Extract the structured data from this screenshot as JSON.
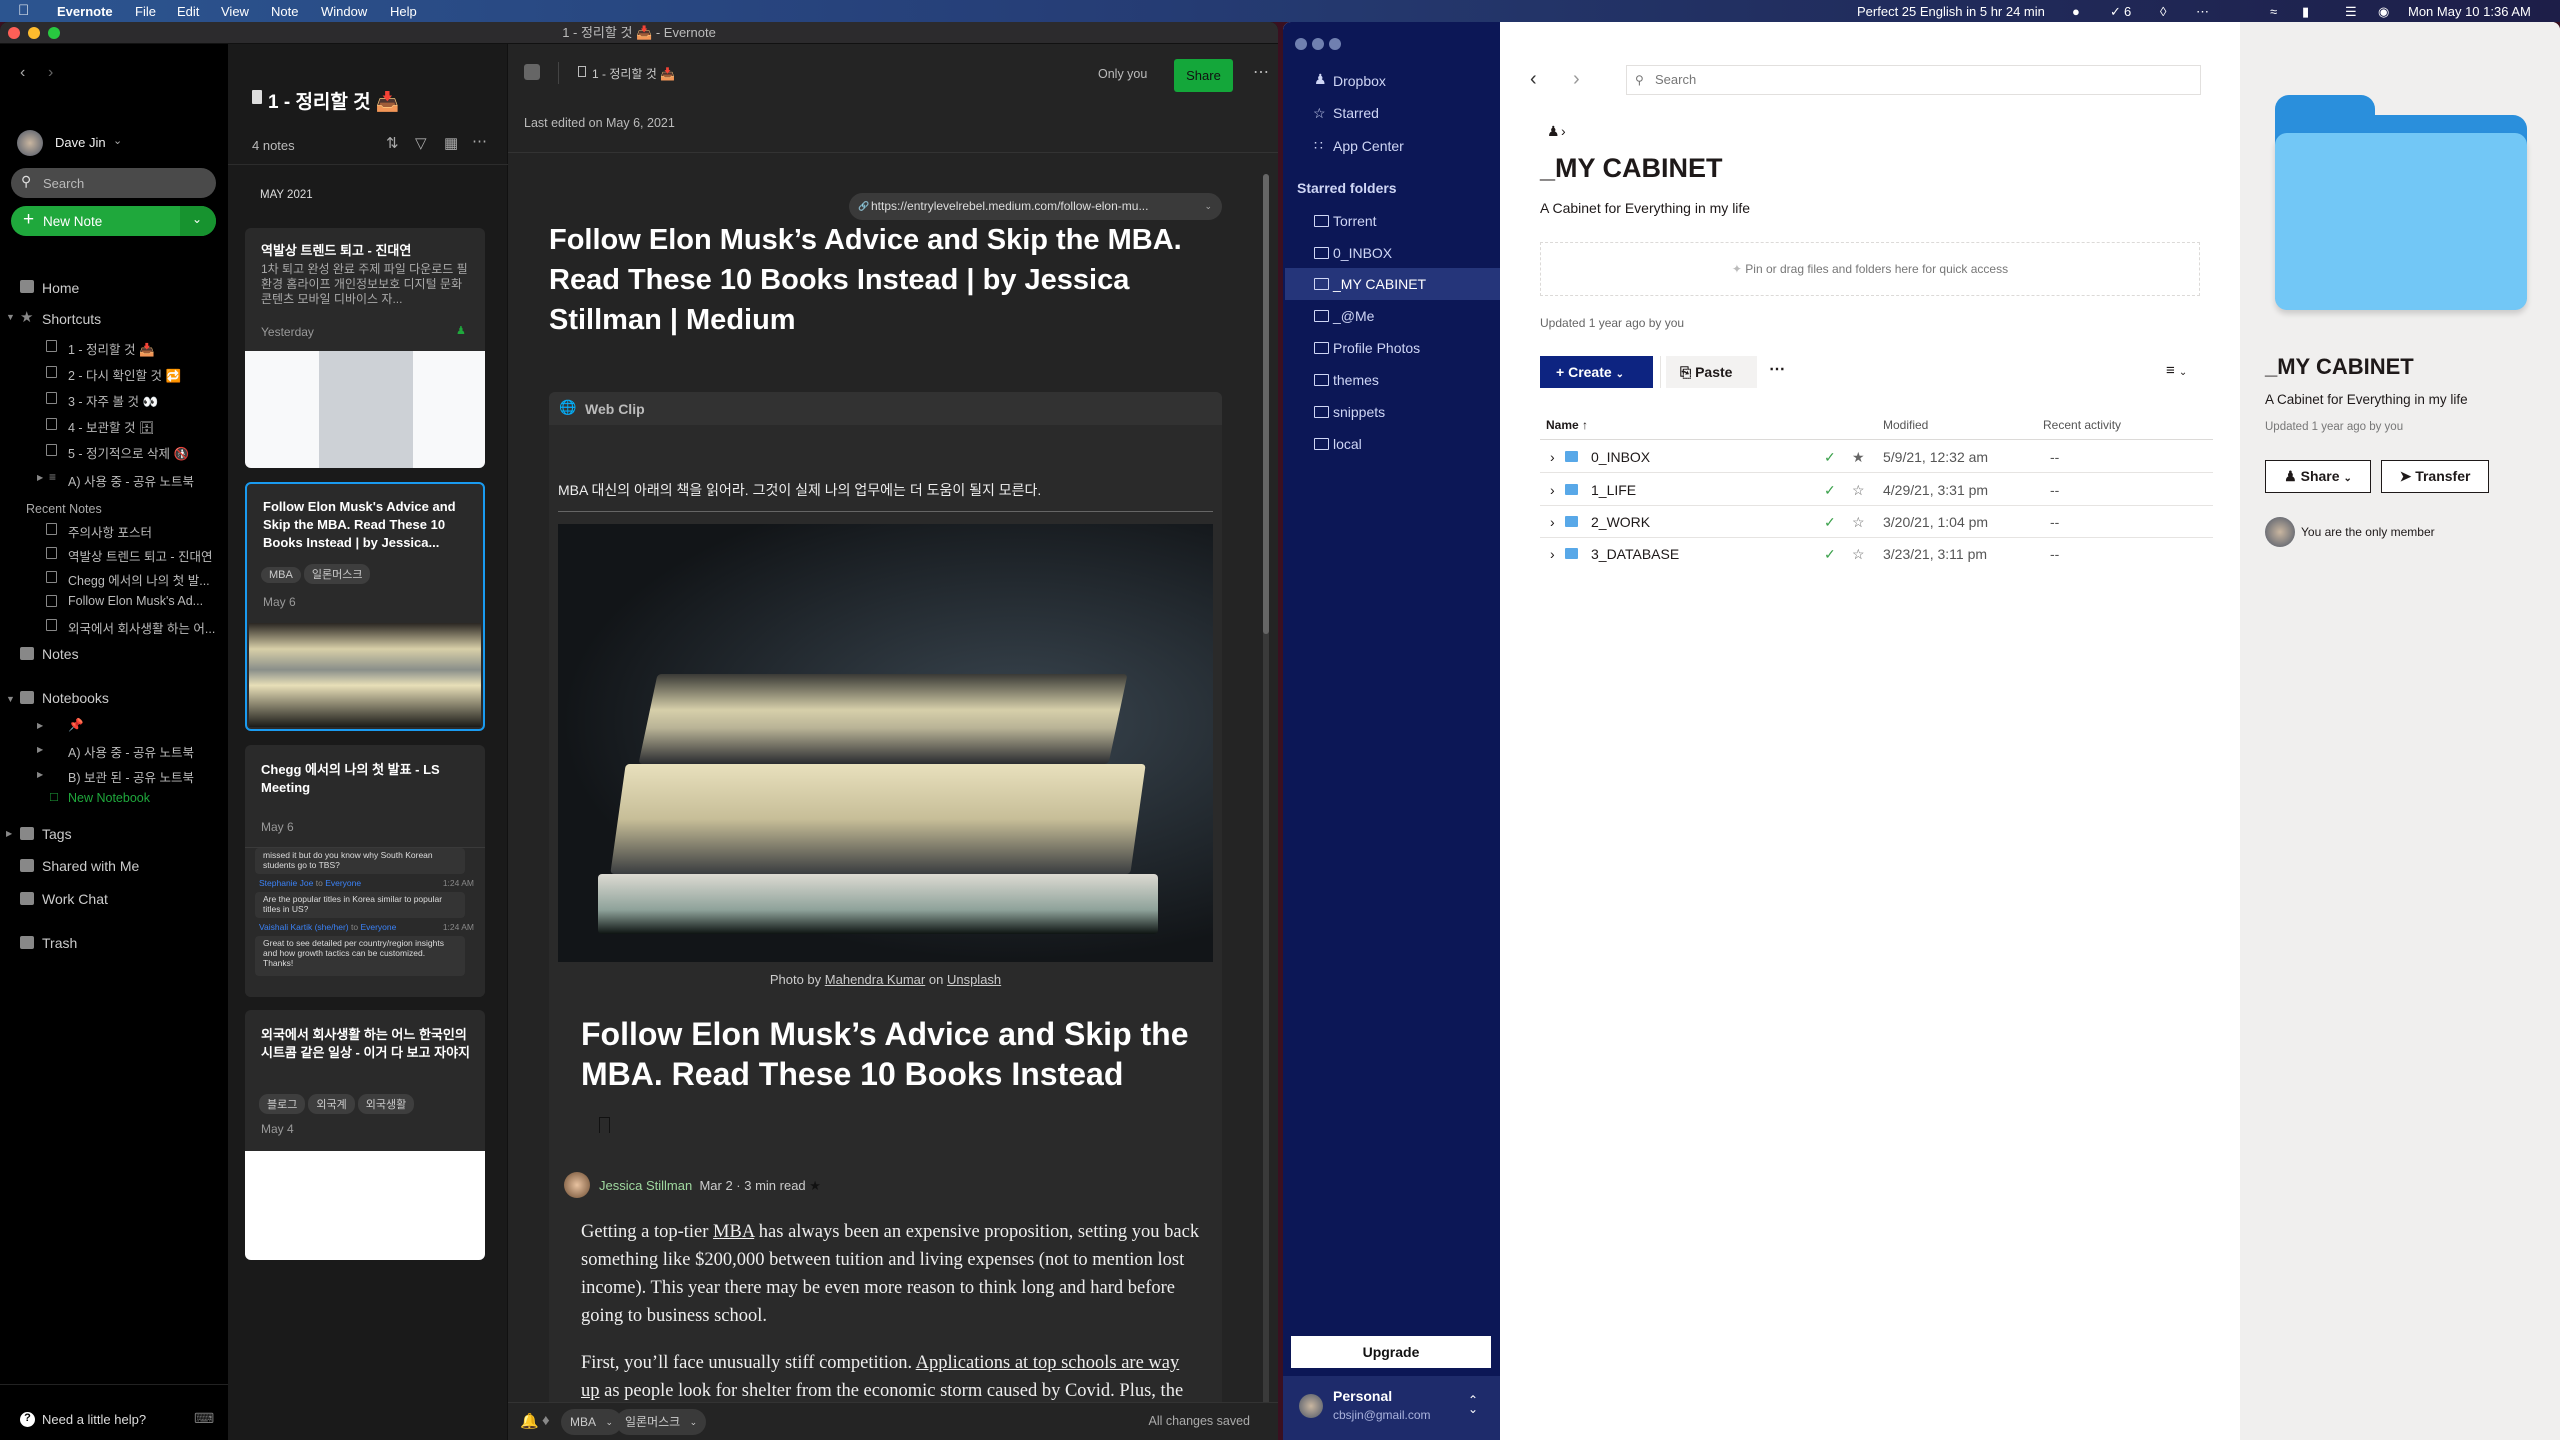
{
  "menubar": {
    "app": "Evernote",
    "items": [
      "File",
      "Edit",
      "View",
      "Note",
      "Window",
      "Help"
    ],
    "status": "Perfect 25 English in 5 hr 24 min",
    "badge": "6",
    "clock": "Mon May 10  1:36 AM"
  },
  "evernote": {
    "window_title": "1 - 정리할 것 📥 - Evernote",
    "sidebar": {
      "user": "Dave Jin",
      "search_placeholder": "Search",
      "new_note": "New Note",
      "home": "Home",
      "shortcuts": "Shortcuts",
      "shortcut_items": [
        "1 - 정리할 것 📥",
        "2 - 다시 확인할 것 🔁",
        "3 - 자주 볼 것 👀",
        "4 - 보관할 것 🗄",
        "5 - 정기적으로 삭제 🚯",
        "A) 사용 중 - 공유 노트북"
      ],
      "recent_label": "Recent Notes",
      "recent_items": [
        "주의사항 포스터",
        "역발상 트렌드 퇴고 - 진대연",
        "Chegg 에서의 나의 첫 발...",
        "Follow Elon Musk's Ad...",
        "외국에서 회사생활 하는 어..."
      ],
      "notes": "Notes",
      "notebooks": "Notebooks",
      "notebook_items": [
        "📌",
        "A) 사용 중 - 공유 노트북",
        "B) 보관 된 - 공유 노트북"
      ],
      "new_notebook": "New Notebook",
      "tags": "Tags",
      "shared": "Shared with Me",
      "work_chat": "Work Chat",
      "trash": "Trash",
      "help": "Need a little help?"
    },
    "note_list": {
      "title": "1 - 정리할 것 📥",
      "count": "4 notes",
      "month": "MAY 2021",
      "cards": [
        {
          "title": "역발상 트렌드 퇴고 - 진대연",
          "snippet": "1차 퇴고 완성 완료 주제 파일 다운로드 필환경 홈라이프 개인정보보호 디지털 문화 콘텐츠 모바일 디바이스 자...",
          "date": "Yesterday"
        },
        {
          "title": "Follow Elon Musk's Advice and Skip the MBA. Read These 10 Books Instead | by Jessica...",
          "tags": [
            "MBA",
            "일론머스크"
          ],
          "date": "May 6"
        },
        {
          "title": "Chegg 에서의 나의 첫 발표 - LS Meeting",
          "date": "May 6",
          "chat": [
            {
              "msg": "missed it but do you know why South Korean students go to TBS?"
            },
            {
              "from": "Stephanie Joe",
              "to": "to",
              "target": "Everyone",
              "time": "1:24 AM",
              "msg": "Are the popular titles in Korea similar to popular titles in US?"
            },
            {
              "from": "Vaishali Kartik (she/her)",
              "to": "to",
              "target": "Everyone",
              "time": "1:24 AM",
              "msg": "Great to see detailed per country/region insights and how growth tactics can be customized. Thanks!"
            }
          ]
        },
        {
          "title": "외국에서 회사생활 하는 어느 한국인의 시트콤 같은 일상 - 이거 다 보고 자야지",
          "tags": [
            "블로그",
            "외국계",
            "외국생활"
          ],
          "date": "May 4"
        }
      ]
    },
    "editor": {
      "breadcrumb": "1 - 정리할 것 📥",
      "visibility": "Only you",
      "share": "Share",
      "last_edited": "Last edited on May 6, 2021",
      "url": "https://entrylevelrebel.medium.com/follow-elon-mu...",
      "title": "Follow Elon Musk’s Advice and Skip the MBA. Read These 10 Books Instead | by Jessica Stillman | Medium",
      "webclip": "Web Clip",
      "intro": "MBA 대신의 아래의 책을 읽어라. 그것이 실제 나의 업무에는 더 도움이 될지 모른다.",
      "caption": {
        "pre": "Photo by",
        "author": "Mahendra Kumar",
        "mid": "on",
        "site": "Unsplash"
      },
      "heading": "Follow Elon Musk’s Advice and Skip the MBA. Read These 10 Books Instead",
      "author": "Jessica Stillman",
      "date": "Mar 2",
      "read": "3 min read",
      "p1": {
        "a": "Getting a top-tier ",
        "link": "MBA",
        "b": " has always been an expensive proposition, setting you back something like $200,000 between tuition and living expenses (not to mention lost income). This year there may be even more reason to think long and hard before going to business school."
      },
      "p2": {
        "a": "First, you’ll face unusually stiff competition. ",
        "link": "Applications at top schools are way up",
        "b": " as people look for shelter from the economic storm caused by Covid. Plus, the virus may continue to disrupt in-person instruction, so you could"
      },
      "tags": [
        "MBA",
        "일론머스크"
      ],
      "status": "All changes saved"
    }
  },
  "dropbox": {
    "sidebar": {
      "items": [
        "Dropbox",
        "Starred",
        "App Center"
      ],
      "starred_label": "Starred folders",
      "folders": [
        "Torrent",
        "0_INBOX",
        "_MY CABINET",
        "_@Me",
        "Profile Photos",
        "themes",
        "snippets",
        "local"
      ],
      "upgrade": "Upgrade",
      "account": "Personal",
      "email": "cbsjin@gmail.com"
    },
    "main": {
      "search_placeholder": "Search",
      "title": "_MY CABINET",
      "subtitle": "A Cabinet for Everything in my life",
      "pin_hint": "Pin or drag files and folders here for quick access",
      "updated": "Updated 1 year ago by you",
      "create": "Create",
      "paste": "Paste",
      "columns": [
        "Name",
        "Modified",
        "Recent activity"
      ],
      "rows": [
        {
          "name": "0_INBOX",
          "modified": "5/9/21, 12:32 am",
          "activity": "--",
          "starred": true
        },
        {
          "name": "1_LIFE",
          "modified": "4/29/21, 3:31 pm",
          "activity": "--",
          "starred": false
        },
        {
          "name": "2_WORK",
          "modified": "3/20/21, 1:04 pm",
          "activity": "--",
          "starred": false
        },
        {
          "name": "3_DATABASE",
          "modified": "3/23/21, 3:11 pm",
          "activity": "--",
          "starred": false
        }
      ]
    },
    "panel": {
      "title": "_MY CABINET",
      "subtitle": "A Cabinet for Everything in my life",
      "updated": "Updated 1 year ago by you",
      "share": "Share",
      "transfer": "Transfer",
      "member": "You are the only member"
    }
  },
  "colors": {
    "evernote_green": "#1fa83c",
    "dropbox_blue": "#0d2481",
    "dropbox_sidebar": "#0c1756",
    "selection_blue": "#1a9bf0"
  }
}
